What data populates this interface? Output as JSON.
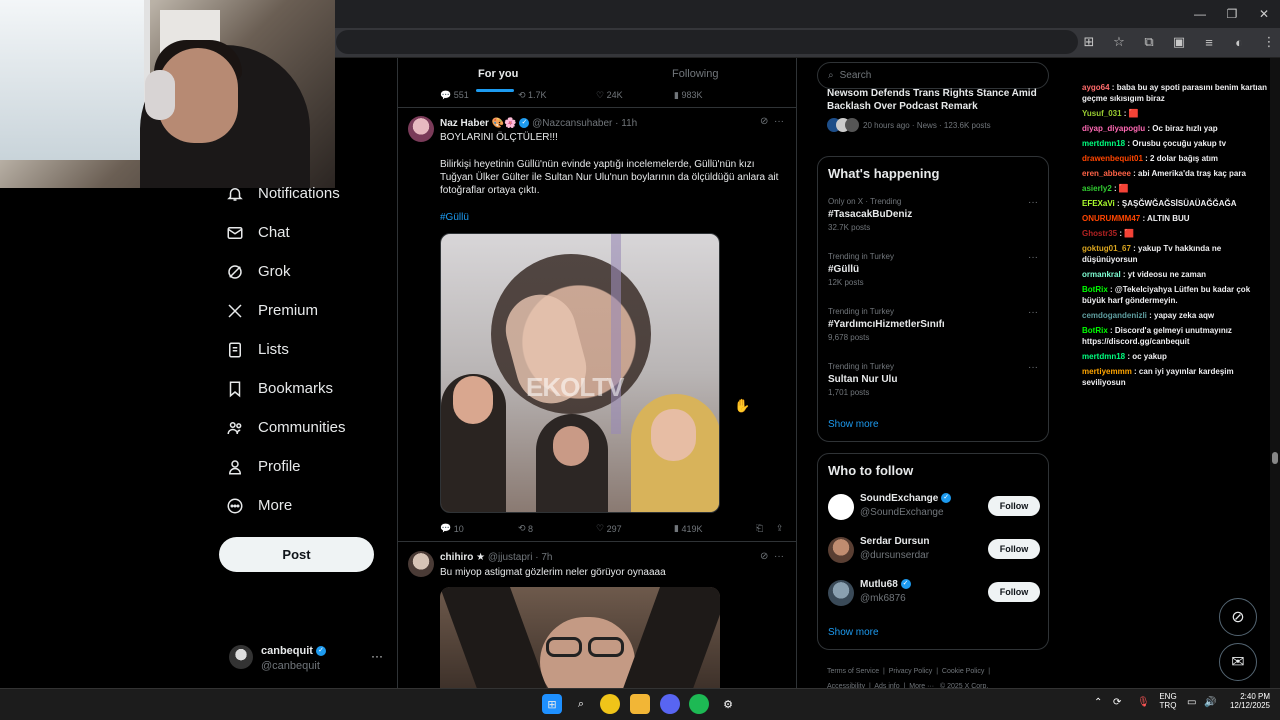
{
  "browser": {
    "window_controls": [
      "—",
      "❐",
      "✕"
    ]
  },
  "nav": {
    "items": [
      {
        "label": "Notifications",
        "icon": "bell-icon"
      },
      {
        "label": "Chat",
        "icon": "mail-icon"
      },
      {
        "label": "Grok",
        "icon": "grok-icon"
      },
      {
        "label": "Premium",
        "icon": "x-logo-icon"
      },
      {
        "label": "Lists",
        "icon": "list-icon"
      },
      {
        "label": "Bookmarks",
        "icon": "bookmark-icon"
      },
      {
        "label": "Communities",
        "icon": "people-icon"
      },
      {
        "label": "Profile",
        "icon": "person-icon"
      },
      {
        "label": "More",
        "icon": "more-circle-icon"
      }
    ],
    "post_label": "Post",
    "account": {
      "name": "canbequit",
      "handle": "@canbequit",
      "more": "···"
    }
  },
  "timeline": {
    "tabs": {
      "for_you": "For you",
      "following": "Following"
    },
    "top_actions": {
      "replies": "551",
      "reposts": "1.7K",
      "likes": "24K",
      "views": "983K"
    },
    "tweets": [
      {
        "name": "Naz Haber",
        "emoji": "🎨🌸",
        "handle": "@Nazcansuhaber",
        "time": "· 11h",
        "headline": "BOYLARINI ÖLÇTÜLER!!!",
        "body": "Bilirkişi heyetinin Güllü'nün evinde yaptığı incelemelerde, Güllü'nün kızı Tuğyan Ülker Gülter ile Sultan Nur Ulu'nun boylarının da ölçüldüğü anlara ait fotoğraflar ortaya çıktı.",
        "hashtag": "#Güllü",
        "image_watermark": "EKOLTV",
        "replies": "10",
        "reposts": "8",
        "likes": "297",
        "views": "419K"
      },
      {
        "name": "chihiro",
        "emoji": "★",
        "handle": "@jjustapri",
        "time": "· 7h",
        "body": "Bu miyop astigmat gözlerim neler görüyor oynaaaa"
      }
    ]
  },
  "sidebar": {
    "search_placeholder": "Search",
    "news": {
      "title": "Newsom Defends Trans Rights Stance Amid Backlash Over Podcast Remark",
      "meta": "20 hours ago · News · 123.6K posts"
    },
    "whats_happening": {
      "heading": "What's happening",
      "trends": [
        {
          "meta": "Only on X · Trending",
          "title": "#TasacakBuDeniz",
          "count": "32.7K posts"
        },
        {
          "meta": "Trending in Turkey",
          "title": "#Güllü",
          "count": "12K posts"
        },
        {
          "meta": "Trending in Turkey",
          "title": "#YardımcıHizmetlerSınıfı",
          "count": "9,678 posts"
        },
        {
          "meta": "Trending in Turkey",
          "title": "Sultan Nur Ulu",
          "count": "1,701 posts"
        }
      ],
      "show_more": "Show more"
    },
    "who_to_follow": {
      "heading": "Who to follow",
      "accounts": [
        {
          "name": "SoundExchange",
          "handle": "@SoundExchange",
          "verified": true,
          "button": "Follow"
        },
        {
          "name": "Serdar Dursun",
          "handle": "@dursunserdar",
          "verified": false,
          "button": "Follow"
        },
        {
          "name": "Mutlu68",
          "handle": "@mk6876",
          "verified": true,
          "button": "Follow"
        }
      ],
      "show_more": "Show more"
    },
    "footer": {
      "links": [
        "Terms of Service",
        "Privacy Policy",
        "Cookie Policy",
        "Accessibility",
        "Ads info",
        "More ···",
        "© 2025 X Corp."
      ]
    }
  },
  "chat": {
    "messages": [
      {
        "user": "aygo64",
        "color": "#ff6b6b",
        "text": "baba bu ay spoti parasını benim kartıan geçme sıkısıgım biraz"
      },
      {
        "user": "Yusuf_031",
        "color": "#9acd32",
        "text": "🟥"
      },
      {
        "user": "diyap_diyapoglu",
        "color": "#ff69b4",
        "text": "Oc biraz hızlı yap"
      },
      {
        "user": "mertdmn18",
        "color": "#00ff7f",
        "text": "Orusbu çocuğu yakup tv"
      },
      {
        "user": "drawenbequit01",
        "color": "#ff4500",
        "text": "2 dolar bağış atım"
      },
      {
        "user": "eren_abbeee",
        "color": "#ff6347",
        "text": "abi Amerika'da traş kaç para"
      },
      {
        "user": "asierly2",
        "color": "#32cd32",
        "text": "🟥"
      },
      {
        "user": "EFEXaVi",
        "color": "#adff2f",
        "text": "ŞAŞĞWĞAĞSİSÜAÜAĞĞAĞA"
      },
      {
        "user": "ONURUMMM47",
        "color": "#ff4500",
        "text": "ALTIN BUU"
      },
      {
        "user": "Ghostr35",
        "color": "#b22222",
        "text": "🟥"
      },
      {
        "user": "goktug01_67",
        "color": "#daa520",
        "text": "yakup Tv hakkında ne düşünüyorsun"
      },
      {
        "user": "ormankral",
        "color": "#7fffd4",
        "text": "yt videosu ne zaman"
      },
      {
        "user": "BotRix",
        "color": "#00ff00",
        "text": "@Tekelciyahya Lütfen bu kadar çok büyük harf göndermeyin."
      },
      {
        "user": "cemdogandenizli",
        "color": "#5f9ea0",
        "text": "yapay zeka aqw"
      },
      {
        "user": "BotRix",
        "color": "#00ff00",
        "text": "Discord'a gelmeyi unutmayınız https://discord.gg/canbequit"
      },
      {
        "user": "mertdmn18",
        "color": "#00ff7f",
        "text": "oc yakup"
      },
      {
        "user": "mertiyemmm",
        "color": "#ffa500",
        "text": "can iyi yayınlar kardeşim seviliyosun"
      }
    ]
  },
  "taskbar": {
    "lang": "ENG",
    "region": "TRQ",
    "time": "2:40 PM",
    "date": "12/12/2025"
  }
}
